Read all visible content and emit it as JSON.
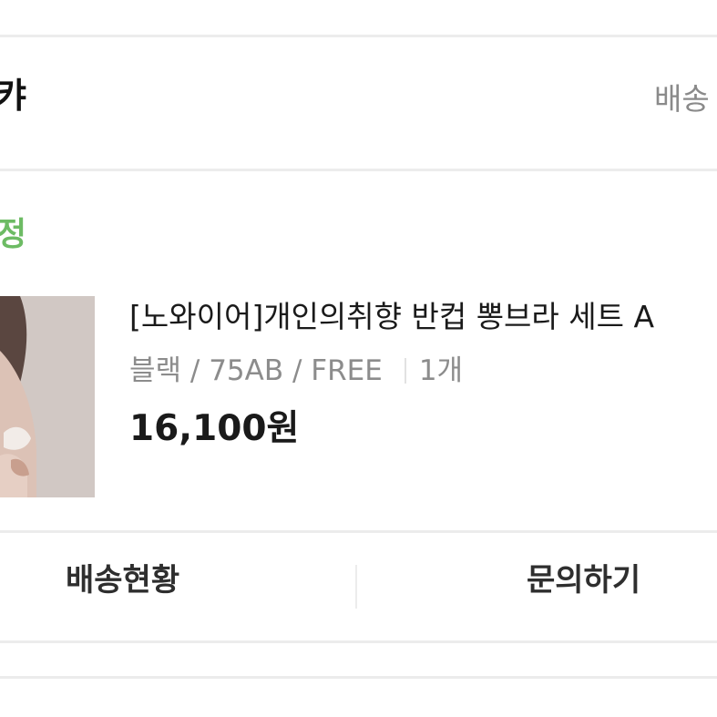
{
  "header": {
    "title": "캬",
    "link_label": "배송"
  },
  "order": {
    "status": "정"
  },
  "product": {
    "name": "[노와이어]개인의취향 반컵 뽕브라 세트 A",
    "option": "블랙 / 75AB / FREE",
    "quantity": "1개",
    "price": "16,100원"
  },
  "actions": {
    "delivery_status_label": "배송현황",
    "inquiry_label": "문의하기"
  },
  "colors": {
    "status_green": "#6dbb64",
    "divider": "#ececec",
    "secondary_text": "#8c8c8c"
  },
  "icons": {
    "thumbnail": "product-photo"
  }
}
